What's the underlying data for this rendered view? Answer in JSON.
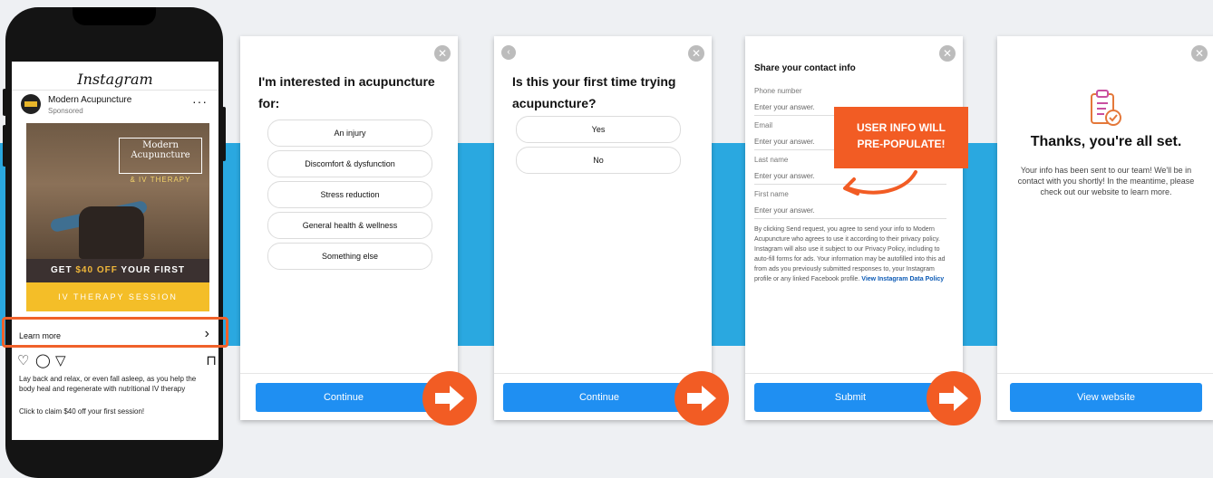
{
  "colors": {
    "band": "#2aa8e0",
    "accent": "#f25c24",
    "primary": "#1f8ff2"
  },
  "phone": {
    "app_name": "Instagram",
    "account_name": "Modern Acupuncture",
    "sponsored": "Sponsored",
    "more": "···",
    "ad": {
      "brand_line1": "Modern",
      "brand_line2": "Acupuncture",
      "brand_sub": "& IV THERAPY",
      "promo_pre": "GET ",
      "promo_highlight": "$40 OFF",
      "promo_post": " YOUR FIRST",
      "session": "IV THERAPY SESSION"
    },
    "learn_more": "Learn more",
    "caption": "Lay back and relax, or even fall asleep, as you help the body heal and regenerate with nutritional IV therapy",
    "claim": "Click to claim $40 off your first session!"
  },
  "card1": {
    "question": "I'm interested in acupuncture for:",
    "options": [
      "An injury",
      "Discomfort & dysfunction",
      "Stress reduction",
      "General health & wellness",
      "Something else"
    ],
    "button": "Continue"
  },
  "card2": {
    "question": "Is this your first time trying acupuncture?",
    "options": [
      "Yes",
      "No"
    ],
    "button": "Continue"
  },
  "card3": {
    "title": "Share your contact info",
    "fields": [
      {
        "label": "Phone number",
        "placeholder": "Enter your answer."
      },
      {
        "label": "Email",
        "placeholder": "Enter your answer."
      },
      {
        "label": "Last name",
        "placeholder": "Enter your answer."
      },
      {
        "label": "First name",
        "placeholder": "Enter your answer."
      }
    ],
    "disclaimer": "By clicking Send request, you agree to send your info to Modern Acupuncture who agrees to use it according to their privacy policy. Instagram will also use it subject to our Privacy Policy, including to auto-fill forms for ads. Your information may be autofilled into this ad from ads you previously submitted responses to, your Instagram profile or any linked Facebook profile.",
    "policy_link": "View Instagram Data Policy",
    "button": "Submit"
  },
  "callout": {
    "line1": "USER INFO WILL",
    "line2": "PRE-POPULATE!"
  },
  "card4": {
    "title": "Thanks, you're all set.",
    "message": "Your info has been sent to our team! We'll be in contact with you shortly! In the meantime, please check out our website to learn more.",
    "button": "View website"
  }
}
